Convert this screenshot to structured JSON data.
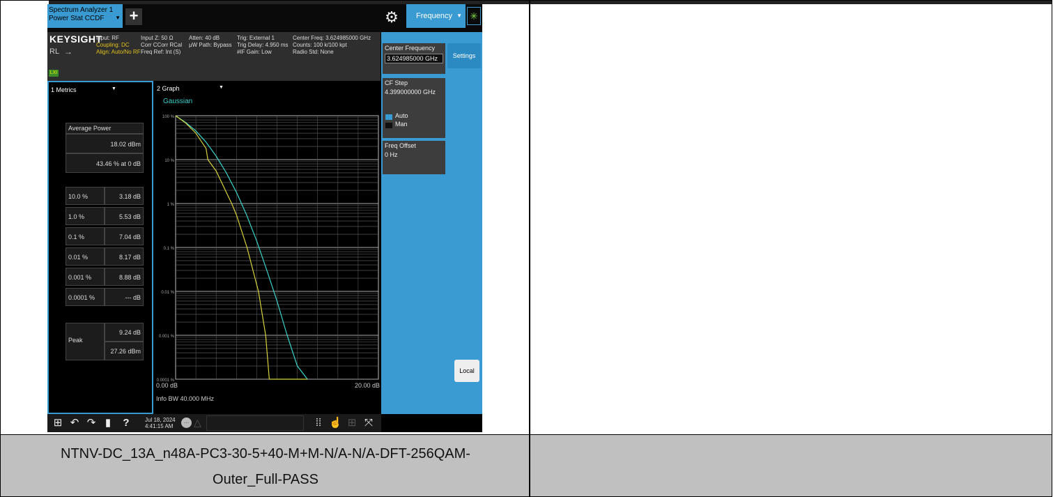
{
  "window": {
    "app_line1": "Spectrum Analyzer 1",
    "app_line2": "Power Stat CCDF",
    "measure_tab": "Frequency"
  },
  "header": {
    "brand": "KEYSIGHT",
    "rl": "RL",
    "lxi": "LXI",
    "col1": [
      "Input: RF",
      "Coupling: DC",
      "Align: Auto/No RF"
    ],
    "col2": [
      "Input Z: 50 Ω",
      "Corr CCorr RCal",
      "Freq Ref: Int (S)"
    ],
    "col3": [
      "Atten: 40 dB",
      "µW Path: Bypass",
      ""
    ],
    "col4": [
      "Trig: External 1",
      "Trig Delay: 4.950 ms",
      "#IF Gain: Low"
    ],
    "col5": [
      "Center Freq: 3.624985000 GHz",
      "Counts: 100 k/100 kpt",
      "Radio Std: None"
    ]
  },
  "metrics": {
    "title": "1 Metrics",
    "avg_label": "Average Power",
    "avg_dbm": "18.02 dBm",
    "avg_pct": "43.46 % at 0 dB",
    "rows": [
      {
        "pct": "10.0 %",
        "db": "3.18 dB"
      },
      {
        "pct": "1.0 %",
        "db": "5.53 dB"
      },
      {
        "pct": "0.1 %",
        "db": "7.04 dB"
      },
      {
        "pct": "0.01 %",
        "db": "8.17 dB"
      },
      {
        "pct": "0.001 %",
        "db": "8.88 dB"
      },
      {
        "pct": "0.0001 %",
        "db": "--- dB"
      }
    ],
    "peak_label": "Peak",
    "peak_db": "9.24 dB",
    "peak_dbm": "27.26 dBm"
  },
  "graph": {
    "title": "2 Graph",
    "trace_label": "Gaussian",
    "x_start": "0.00 dB",
    "x_stop": "20.00 dB",
    "info_bw": "Info BW 40.000 MHz",
    "y_ticks": [
      "100 %",
      "10 %",
      "1 %",
      "0.1 %",
      "0.01 %",
      "0.001 %",
      "0.0001 %"
    ]
  },
  "chart_data": {
    "type": "line",
    "xlabel": "",
    "ylabel": "",
    "xlim": [
      0,
      20
    ],
    "ylim": [
      0.0001,
      100
    ],
    "y_scale": "log",
    "series": [
      {
        "name": "Gaussian",
        "color": "#3ad2cc",
        "x": [
          0,
          1,
          2,
          3,
          4,
          5,
          6,
          7,
          8,
          9,
          10,
          11,
          12,
          13
        ],
        "y": [
          100,
          70,
          45,
          25,
          12,
          5,
          1.8,
          0.55,
          0.14,
          0.03,
          0.006,
          0.001,
          0.0002,
          0.0001
        ]
      },
      {
        "color": "#d8d23a",
        "x": [
          0,
          1,
          2,
          3,
          3.18,
          4,
          5,
          5.53,
          6,
          7.04,
          8.17,
          8.88,
          9.24,
          13
        ],
        "y": [
          100,
          68,
          40,
          18,
          10,
          5.5,
          1.8,
          1.0,
          0.55,
          0.1,
          0.01,
          0.001,
          0.0001,
          0.0001
        ]
      }
    ]
  },
  "softkeys": {
    "center_freq_label": "Center Frequency",
    "center_freq_val": "3.624985000 GHz",
    "cf_step_label": "CF Step",
    "cf_step_val": "4.399000000 GHz",
    "auto": "Auto",
    "man": "Man",
    "freq_offset_label": "Freq Offset",
    "freq_offset_val": "0 Hz",
    "settings": "Settings",
    "local": "Local"
  },
  "taskbar": {
    "date": "Jul 18, 2024",
    "time": "4:41:15 AM"
  },
  "caption": {
    "line1": "NTNV-DC_13A_n48A-PC3-30-5+40-M+M-N/A-N/A-DFT-256QAM-",
    "line2": "Outer_Full-PASS"
  },
  "colors": {
    "accent": "#3a9bd2",
    "gaussian": "#3ad2cc",
    "measured": "#d8d23a"
  }
}
